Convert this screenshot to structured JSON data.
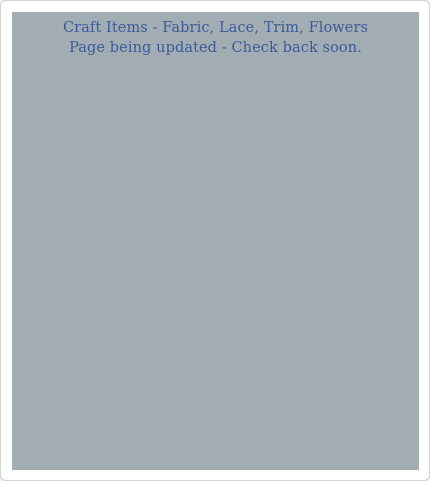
{
  "colors": {
    "page_background": "#ffffff",
    "panel_background": "#a2adb3",
    "text_color": "#3a5a9a"
  },
  "notice": {
    "heading": "Craft Items - Fabric, Lace, Trim, Flowers",
    "message": "Page being updated - Check back soon."
  }
}
